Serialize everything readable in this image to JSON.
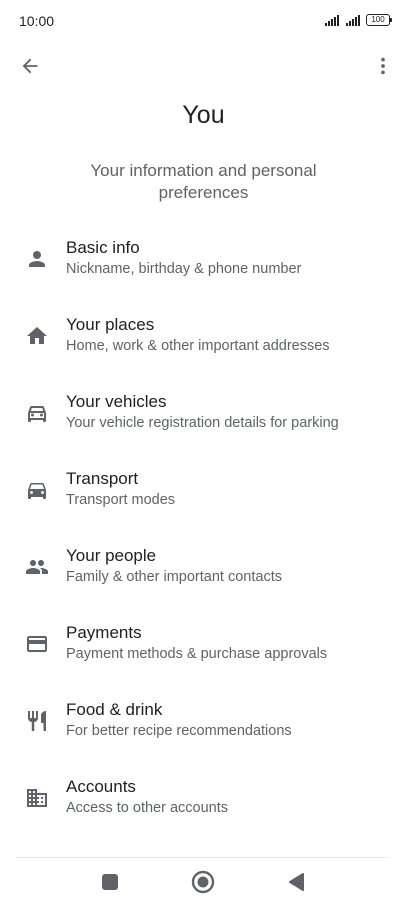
{
  "status": {
    "time": "10:00",
    "battery": "100"
  },
  "header": {
    "title": "You",
    "subtitle": "Your information and personal preferences"
  },
  "menu": {
    "items": [
      {
        "title": "Basic info",
        "desc": "Nickname, birthday & phone number",
        "icon": "person-icon"
      },
      {
        "title": "Your places",
        "desc": "Home, work & other important addresses",
        "icon": "home-icon"
      },
      {
        "title": "Your vehicles",
        "desc": "Your vehicle registration details for parking",
        "icon": "car-icon"
      },
      {
        "title": "Transport",
        "desc": "Transport modes",
        "icon": "car-icon"
      },
      {
        "title": "Your people",
        "desc": "Family & other important contacts",
        "icon": "people-icon"
      },
      {
        "title": "Payments",
        "desc": "Payment methods & purchase approvals",
        "icon": "credit-card-icon"
      },
      {
        "title": "Food & drink",
        "desc": "For better recipe recommendations",
        "icon": "restaurant-icon"
      },
      {
        "title": "Accounts",
        "desc": "Access to other accounts",
        "icon": "building-icon"
      }
    ]
  },
  "colors": {
    "icon": "#5f6368",
    "text": "#202124",
    "secondary": "#5f6368"
  }
}
